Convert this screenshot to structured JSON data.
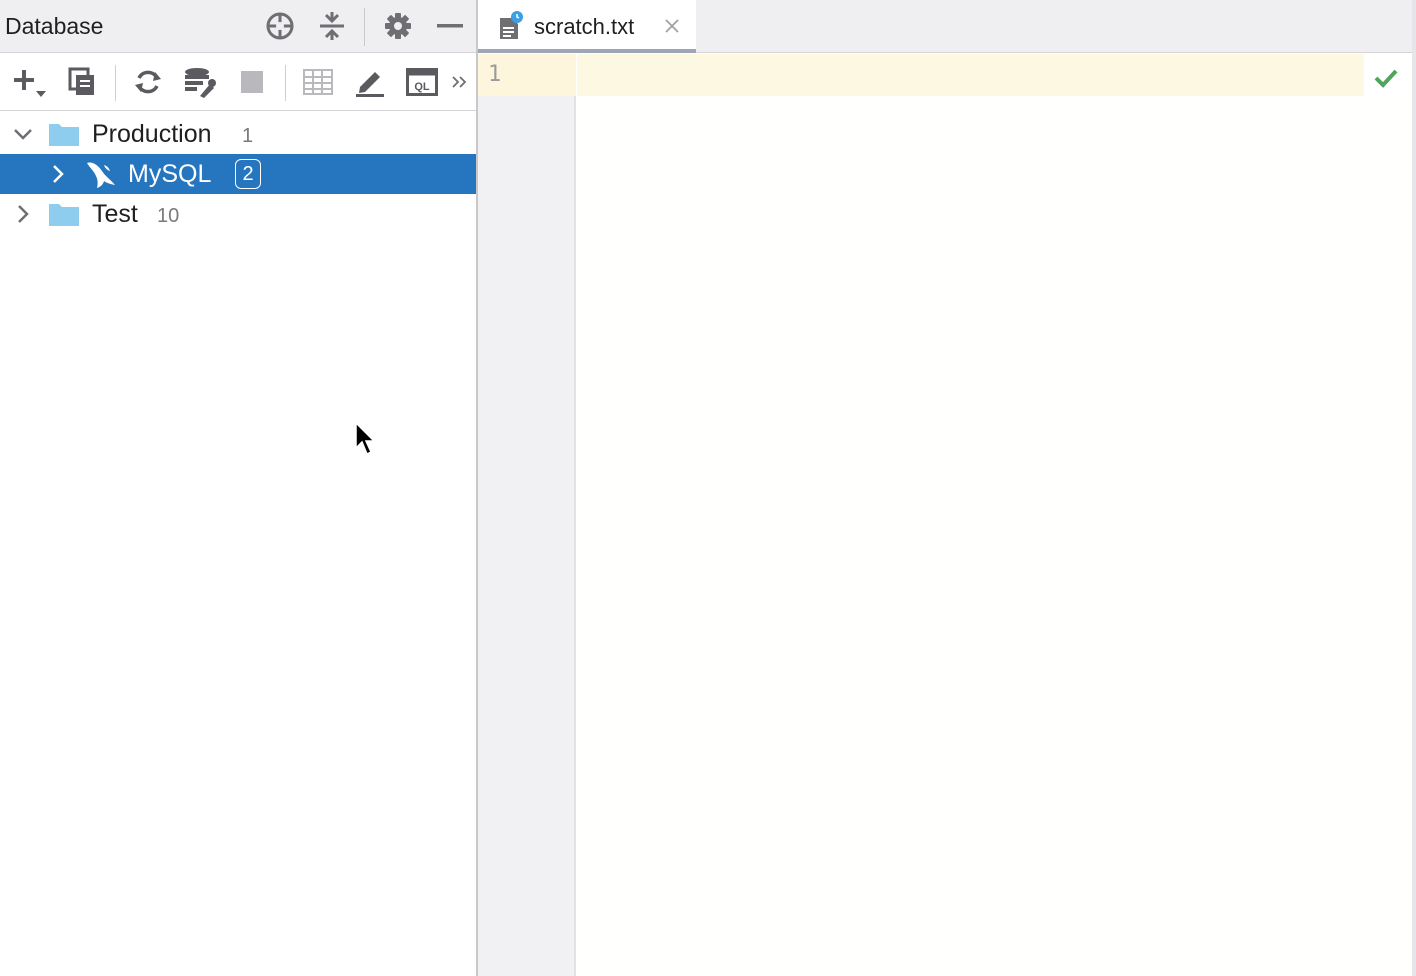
{
  "database_panel": {
    "title": "Database",
    "header_actions": [
      {
        "name": "locate-icon"
      },
      {
        "name": "collapse-all-icon"
      },
      {
        "name": "gear-icon"
      },
      {
        "name": "minimize-icon"
      }
    ],
    "toolbar": [
      {
        "name": "add-icon"
      },
      {
        "name": "duplicate-icon"
      },
      {
        "name": "refresh-icon"
      },
      {
        "name": "datasource-properties-icon"
      },
      {
        "name": "stop-icon"
      },
      {
        "name": "table-view-icon"
      },
      {
        "name": "edit-icon"
      },
      {
        "name": "query-console-icon"
      },
      {
        "name": "more-actions-icon"
      }
    ],
    "tree": {
      "production": {
        "label": "Production",
        "count": "1",
        "expanded": true
      },
      "mysql": {
        "label": "MySQL",
        "badge": "2",
        "selected": true,
        "expanded": false
      },
      "test": {
        "label": "Test",
        "count": "10",
        "expanded": false
      }
    }
  },
  "editor": {
    "tab": {
      "label": "scratch.txt",
      "icon": "scratch-file-icon"
    },
    "lines": [
      "1"
    ],
    "status": "inspection-ok-icon"
  },
  "colors": {
    "selection": "#2675bf",
    "folder": "#8ecdee",
    "caret_line": "#fdf8e2",
    "ok_green": "#4ea55b",
    "panel_header": "#efeff2"
  }
}
